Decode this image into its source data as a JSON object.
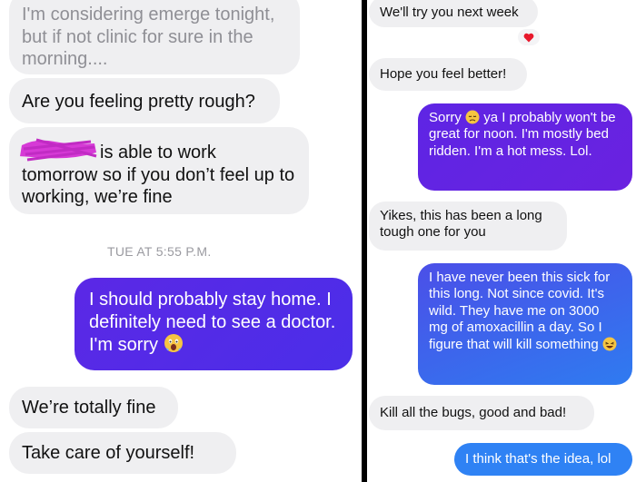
{
  "left": {
    "messages": [
      {
        "id": "l1",
        "text": "I'm considering emerge tonight, but if not clinic for sure in the morning...."
      },
      {
        "id": "l2",
        "text": "Are you feeling pretty rough?"
      },
      {
        "id": "l3",
        "text": "is able to work tomorrow so if you don’t feel up to working, we’re fine"
      },
      {
        "id": "l4",
        "text": "I should probably stay home. I definitely need to see a doctor. I'm sorry"
      },
      {
        "id": "l5",
        "text": "We’re totally fine"
      },
      {
        "id": "l6",
        "text": "Take care of yourself!"
      }
    ],
    "timestamp": "TUE AT 5:55 P.M."
  },
  "right": {
    "messages": [
      {
        "id": "r1",
        "text": "We'll try you next week"
      },
      {
        "id": "r2",
        "text": "Hope you feel better!"
      },
      {
        "id": "r3a",
        "text": "Sorry"
      },
      {
        "id": "r3b",
        "text": "ya I probably won't be great for noon. I'm mostly bed ridden. I'm a hot mess. Lol."
      },
      {
        "id": "r4",
        "text": "Yikes, this has been a long tough one for you"
      },
      {
        "id": "r5",
        "text": "I have never been this sick for this long. Not since covid. It's wild. They have me on 3000 mg of amoxacillin a day. So I figure that will kill something"
      },
      {
        "id": "r6",
        "text": "Kill all the bugs, good and bad!"
      },
      {
        "id": "r7",
        "text": "I think that's the idea, lol"
      }
    ]
  },
  "icons": {
    "redaction": "redaction-scribble-icon",
    "fearful": "fearful-face-emoji-icon",
    "sad": "disappointed-face-emoji-icon",
    "laugh": "rolling-laughing-emoji-icon",
    "heart": "heart-reaction-icon"
  },
  "colors": {
    "incoming": "#efeff1",
    "outgoing_left": "#5b28e6",
    "outgoing_purple": "#6a22e0",
    "outgoing_blue": "#3a6ef0",
    "heart": "#e8192c",
    "redaction": "#d63ad6"
  }
}
